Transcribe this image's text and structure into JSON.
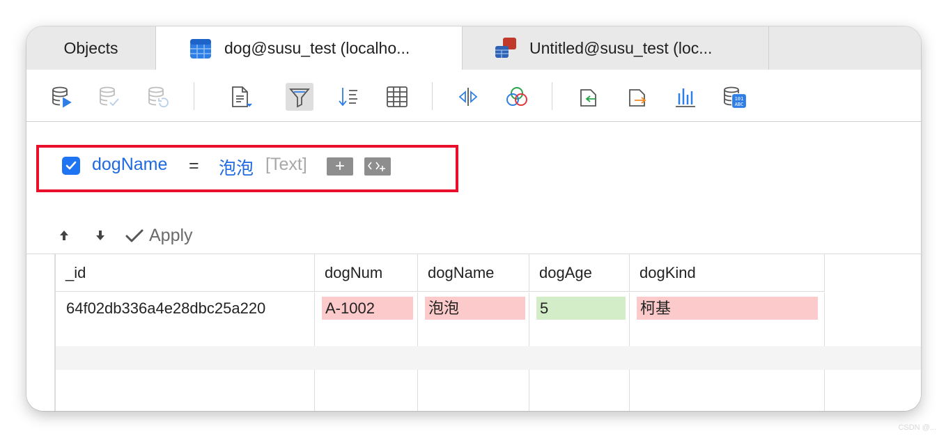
{
  "tabs": [
    {
      "label": "Objects",
      "icon": "objects-tab"
    },
    {
      "label": "dog@susu_test (localho...",
      "icon": "table-icon-blue",
      "active": true
    },
    {
      "label": "Untitled@susu_test (loc...",
      "icon": "query-icon-multi"
    }
  ],
  "toolbar": {
    "icons": [
      "db-run-icon",
      "db-check-icon",
      "db-refresh-icon",
      "document-dropdown-icon",
      "filter-icon",
      "sort-icon",
      "grid-icon",
      "compare-icon",
      "venn-icon",
      "import-icon",
      "export-icon",
      "chart-icon",
      "db-data-icon"
    ],
    "selected": "filter-icon"
  },
  "filter": {
    "checked": true,
    "field": "dogName",
    "operator": "=",
    "value": "泡泡",
    "type": "[Text]",
    "add_label": "+",
    "add_expr_label": "<>+",
    "highlight_color": "#e8102a"
  },
  "apply": {
    "label": "Apply",
    "move_up": "move-up-icon",
    "move_down": "move-down-icon"
  },
  "table": {
    "columns": [
      "_id",
      "dogNum",
      "dogName",
      "dogAge",
      "dogKind"
    ],
    "rows": [
      [
        "64f02db336a4e28dbc25a220",
        "A-1002",
        "泡泡",
        "5",
        "柯基"
      ]
    ],
    "cell_status": [
      "none",
      "changed",
      "changed",
      "new",
      "changed"
    ],
    "colors": {
      "changed": "#fccaca",
      "new": "#d3edc8"
    }
  },
  "watermark": "CSDN @..."
}
